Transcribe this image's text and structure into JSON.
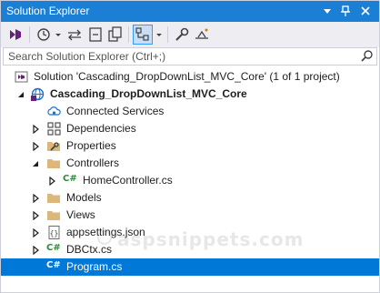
{
  "window": {
    "title": "Solution Explorer",
    "title_buttons": [
      "dropdown-icon",
      "pin-icon",
      "close-icon"
    ]
  },
  "toolbar": {
    "buttons": [
      "vs-project-switch-icon",
      "history-icon",
      "dropdown-icon",
      "sync-icon",
      "collapse-icon",
      "show-all-files-icon",
      "switch-views-icon",
      "properties-wrench-icon",
      "preview-icon"
    ]
  },
  "search": {
    "placeholder": "Search Solution Explorer (Ctrl+;)"
  },
  "tree": {
    "solution": "Solution 'Cascading_DropDownList_MVC_Core' (1 of 1 project)",
    "project": "Cascading_DropDownList_MVC_Core",
    "items": [
      {
        "label": "Connected Services",
        "icon": "cloud-icon"
      },
      {
        "label": "Dependencies",
        "icon": "dependencies-icon"
      },
      {
        "label": "Properties",
        "icon": "wrench-folder-icon"
      },
      {
        "label": "Controllers",
        "icon": "folder-icon"
      },
      {
        "label": "HomeController.cs",
        "icon": "csharp-file-icon"
      },
      {
        "label": "Models",
        "icon": "folder-icon"
      },
      {
        "label": "Views",
        "icon": "folder-icon"
      },
      {
        "label": "appsettings.json",
        "icon": "json-file-icon"
      },
      {
        "label": "DBCtx.cs",
        "icon": "csharp-file-icon"
      },
      {
        "label": "Program.cs",
        "icon": "csharp-file-icon",
        "selected": true
      }
    ]
  },
  "watermark": {
    "text": "aspsnippets.com"
  },
  "colors": {
    "titlebar": "#1c7fd6",
    "selection": "#0078d7",
    "toolbar": "#eeeef2",
    "folder": "#dcb67a",
    "csharp": "#2f8a3b"
  }
}
